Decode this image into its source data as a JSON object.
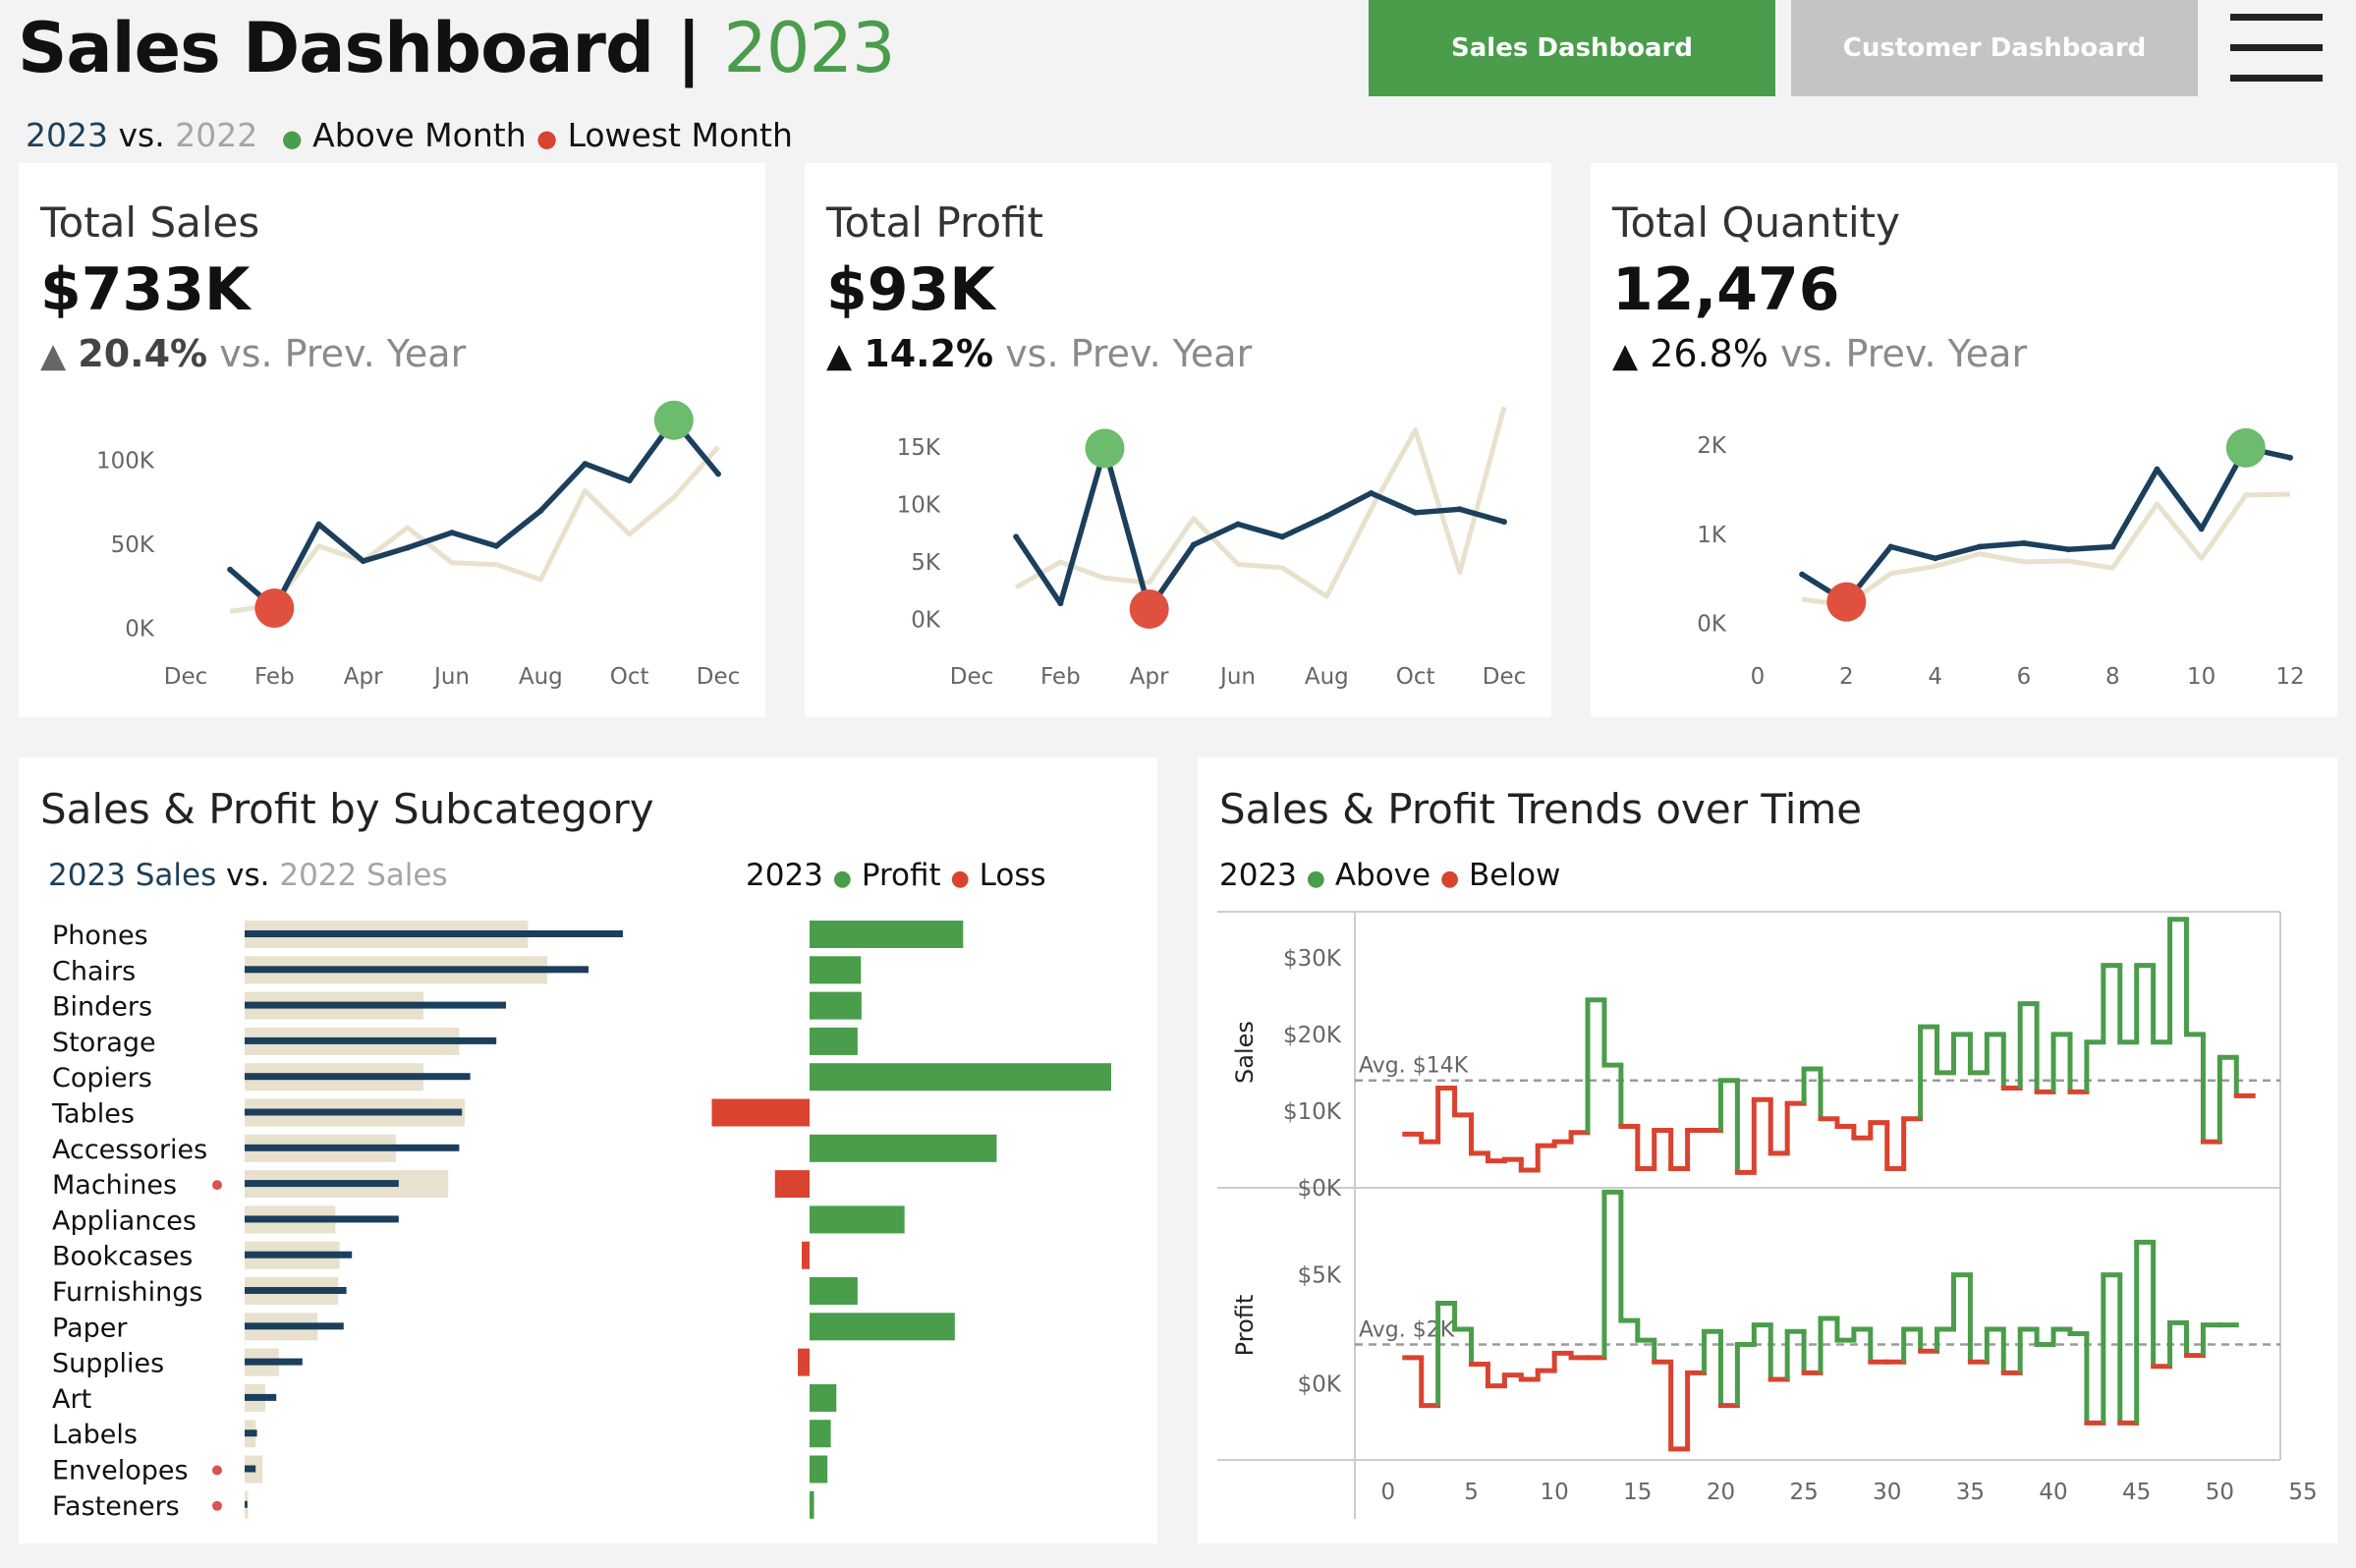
{
  "header": {
    "title": "Sales Dashboard",
    "separator": "|",
    "year": "2023",
    "nav": [
      {
        "label": "Sales Dashboard",
        "active": true
      },
      {
        "label": "Customer Dashboard",
        "active": false
      }
    ],
    "legend": {
      "current": "2023",
      "vs": "vs.",
      "previous": "2022",
      "above": "Above Month",
      "lowest": "Lowest Month"
    }
  },
  "colors": {
    "current": "#1b3f5c",
    "previous": "#e8e1cd",
    "above": "#4a9d4a",
    "below": "#d9432f",
    "highlight_green": "#6dbb6d",
    "highlight_red": "#e0503e"
  },
  "kpis": [
    {
      "title": "Total Sales",
      "value": "$733K",
      "delta": "20.4%",
      "delta_suffix": "vs. Prev. Year"
    },
    {
      "title": "Total Profit",
      "value": "$93K",
      "delta": "14.2%",
      "delta_suffix": "vs. Prev. Year"
    },
    {
      "title": "Total Quantity",
      "value": "12,476",
      "delta": "26.8%",
      "delta_suffix": "vs. Prev. Year"
    }
  ],
  "subcategory": {
    "title": "Sales & Profit by Subcategory",
    "legend_left": {
      "current": "2023 Sales",
      "vs": "vs.",
      "previous": "2022 Sales"
    },
    "legend_right": {
      "year": "2023",
      "profit": "Profit",
      "loss": "Loss"
    }
  },
  "trends": {
    "title": "Sales & Profit Trends over Time",
    "legend": {
      "year": "2023",
      "above": "Above",
      "below": "Below"
    }
  },
  "chart_data": [
    {
      "id": "kpi-sales-line",
      "type": "line",
      "x": [
        1,
        2,
        3,
        4,
        5,
        6,
        7,
        8,
        9,
        10,
        11,
        12
      ],
      "x_ticks": [
        0,
        2,
        4,
        6,
        8,
        10,
        12
      ],
      "x_tick_labels": [
        "Dec",
        "Feb",
        "Apr",
        "Jun",
        "Aug",
        "Oct",
        "Dec"
      ],
      "y_ticks": [
        0,
        50000,
        100000
      ],
      "y_tick_labels": [
        "0K",
        "50K",
        "100K"
      ],
      "ylim": [
        -5000,
        125000
      ],
      "series": [
        {
          "name": "2023",
          "values": [
            35000,
            12000,
            62000,
            40000,
            48000,
            57000,
            49000,
            70000,
            98000,
            88000,
            124000,
            92000
          ]
        },
        {
          "name": "2022",
          "values": [
            10000,
            14000,
            49000,
            40000,
            60000,
            39000,
            38000,
            29000,
            82000,
            56000,
            78000,
            108000
          ]
        }
      ],
      "highlight_max": {
        "x": 11,
        "y": 124000
      },
      "highlight_min": {
        "x": 2,
        "y": 12000
      }
    },
    {
      "id": "kpi-profit-line",
      "type": "line",
      "x": [
        1,
        2,
        3,
        4,
        5,
        6,
        7,
        8,
        9,
        10,
        11,
        12
      ],
      "x_ticks": [
        0,
        2,
        4,
        6,
        8,
        10,
        12
      ],
      "x_tick_labels": [
        "Dec",
        "Feb",
        "Apr",
        "Jun",
        "Aug",
        "Oct",
        "Dec"
      ],
      "y_ticks": [
        0,
        5000,
        10000,
        15000
      ],
      "y_tick_labels": [
        "0K",
        "5K",
        "10K",
        "15K"
      ],
      "ylim": [
        -1500,
        17500
      ],
      "series": [
        {
          "name": "2023",
          "values": [
            7200,
            1400,
            14900,
            900,
            6500,
            8300,
            7200,
            9000,
            11000,
            9300,
            9600,
            8500
          ]
        },
        {
          "name": "2022",
          "values": [
            2800,
            5000,
            3600,
            3200,
            8800,
            4800,
            4500,
            2000,
            9600,
            16500,
            4100,
            18500
          ]
        }
      ],
      "highlight_max": {
        "x": 3,
        "y": 14900
      },
      "highlight_min": {
        "x": 4,
        "y": 900
      }
    },
    {
      "id": "kpi-quantity-line",
      "type": "line",
      "x": [
        1,
        2,
        3,
        4,
        5,
        6,
        7,
        8,
        9,
        10,
        11,
        12
      ],
      "x_ticks": [
        0,
        2,
        4,
        6,
        8,
        10,
        12
      ],
      "x_tick_labels": [
        "0",
        "2",
        "4",
        "6",
        "8",
        "10",
        "12"
      ],
      "y_ticks": [
        0,
        1000,
        2000
      ],
      "y_tick_labels": [
        "0K",
        "1K",
        "2K"
      ],
      "ylim": [
        -150,
        2300
      ],
      "series": [
        {
          "name": "2023",
          "values": [
            550,
            240,
            860,
            730,
            860,
            900,
            830,
            860,
            1730,
            1060,
            1970,
            1860
          ]
        },
        {
          "name": "2022",
          "values": [
            270,
            200,
            560,
            640,
            780,
            690,
            700,
            620,
            1340,
            730,
            1440,
            1450
          ]
        }
      ],
      "highlight_max": {
        "x": 11,
        "y": 1970
      },
      "highlight_min": {
        "x": 2,
        "y": 240
      }
    },
    {
      "id": "subcategory-sales-bars",
      "type": "bar",
      "categories": [
        "Phones",
        "Chairs",
        "Binders",
        "Storage",
        "Copiers",
        "Tables",
        "Accessories",
        "Machines",
        "Appliances",
        "Bookcases",
        "Furnishings",
        "Paper",
        "Supplies",
        "Art",
        "Labels",
        "Envelopes",
        "Fasteners"
      ],
      "flagged": [
        "Machines",
        "Envelopes",
        "Fasteners"
      ],
      "xlim": [
        0,
        400000
      ],
      "series": [
        {
          "name": "2023 Sales",
          "values": [
            275000,
            250000,
            190000,
            183000,
            164000,
            158000,
            156000,
            112000,
            112000,
            78000,
            74000,
            72000,
            42000,
            23000,
            9000,
            8000,
            2000
          ]
        },
        {
          "name": "2022 Sales",
          "values": [
            206000,
            220000,
            130000,
            156000,
            130000,
            160000,
            110000,
            148000,
            66000,
            69000,
            68000,
            53000,
            25000,
            15000,
            8000,
            13000,
            2500
          ]
        }
      ]
    },
    {
      "id": "subcategory-profit-bars",
      "type": "bar",
      "categories": [
        "Phones",
        "Chairs",
        "Binders",
        "Storage",
        "Copiers",
        "Tables",
        "Accessories",
        "Machines",
        "Appliances",
        "Bookcases",
        "Furnishings",
        "Paper",
        "Supplies",
        "Art",
        "Labels",
        "Envelopes",
        "Fasteners"
      ],
      "xlim": [
        -18000,
        55000
      ],
      "values": [
        27500,
        9200,
        9300,
        8600,
        54000,
        -17500,
        33500,
        -6200,
        17000,
        -1400,
        8600,
        26000,
        -2100,
        4800,
        3800,
        3200,
        800
      ]
    },
    {
      "id": "trend-sales-step",
      "type": "line",
      "step": true,
      "ylabel": "Sales",
      "x_ticks": [
        0,
        5,
        10,
        15,
        20,
        25,
        30,
        35,
        40,
        45,
        50,
        55
      ],
      "y_ticks": [
        0,
        10000,
        20000,
        30000
      ],
      "y_tick_labels": [
        "$0K",
        "$10K",
        "$20K",
        "$30K"
      ],
      "ylim": [
        0,
        36000
      ],
      "xlim": [
        -2,
        55
      ],
      "average": 14000,
      "average_label": "Avg. $14K",
      "x": [
        1,
        2,
        3,
        4,
        5,
        6,
        7,
        8,
        9,
        10,
        11,
        12,
        13,
        14,
        15,
        16,
        17,
        18,
        19,
        20,
        21,
        22,
        23,
        24,
        25,
        26,
        27,
        28,
        29,
        30,
        31,
        32,
        33,
        34,
        35,
        36,
        37,
        38,
        39,
        40,
        41,
        42,
        43,
        44,
        45,
        46,
        47,
        48,
        49,
        50,
        51,
        52
      ],
      "values": [
        7000,
        6000,
        13000,
        9500,
        4500,
        3500,
        3700,
        2300,
        5500,
        6000,
        7200,
        24500,
        16000,
        8000,
        2500,
        7500,
        2500,
        7500,
        7500,
        14000,
        2000,
        11500,
        4500,
        11000,
        15500,
        9000,
        8000,
        6500,
        8500,
        2500,
        9000,
        21000,
        15000,
        20000,
        15000,
        20000,
        13000,
        24000,
        12500,
        20000,
        12500,
        19000,
        29000,
        19000,
        29000,
        19000,
        35000,
        20000,
        6000,
        17000,
        12000
      ]
    },
    {
      "id": "trend-profit-step",
      "type": "line",
      "step": true,
      "ylabel": "Profit",
      "x_ticks": [
        0,
        5,
        10,
        15,
        20,
        25,
        30,
        35,
        40,
        45,
        50,
        55
      ],
      "y_ticks": [
        0,
        5000
      ],
      "y_tick_labels": [
        "$0K",
        "$5K"
      ],
      "ylim": [
        -3500,
        9000
      ],
      "xlim": [
        -2,
        55
      ],
      "average": 1800,
      "average_label": "Avg. $2K",
      "x": [
        1,
        2,
        3,
        4,
        5,
        6,
        7,
        8,
        9,
        10,
        11,
        12,
        13,
        14,
        15,
        16,
        17,
        18,
        19,
        20,
        21,
        22,
        23,
        24,
        25,
        26,
        27,
        28,
        29,
        30,
        31,
        32,
        33,
        34,
        35,
        36,
        37,
        38,
        39,
        40,
        41,
        42,
        43,
        44,
        45,
        46,
        47,
        48,
        49,
        50,
        51,
        52
      ],
      "values": [
        1200,
        -1000,
        3700,
        2500,
        900,
        -100,
        400,
        200,
        600,
        1400,
        1200,
        1200,
        8800,
        2900,
        2000,
        1000,
        -3000,
        500,
        2400,
        -1000,
        1800,
        2700,
        200,
        2400,
        500,
        3000,
        2000,
        2500,
        1000,
        1000,
        2500,
        1500,
        2500,
        5000,
        1000,
        2500,
        500,
        2500,
        1800,
        2500,
        2300,
        -1800,
        5000,
        -1800,
        6500,
        800,
        2800,
        1300,
        2700,
        2700
      ]
    }
  ]
}
